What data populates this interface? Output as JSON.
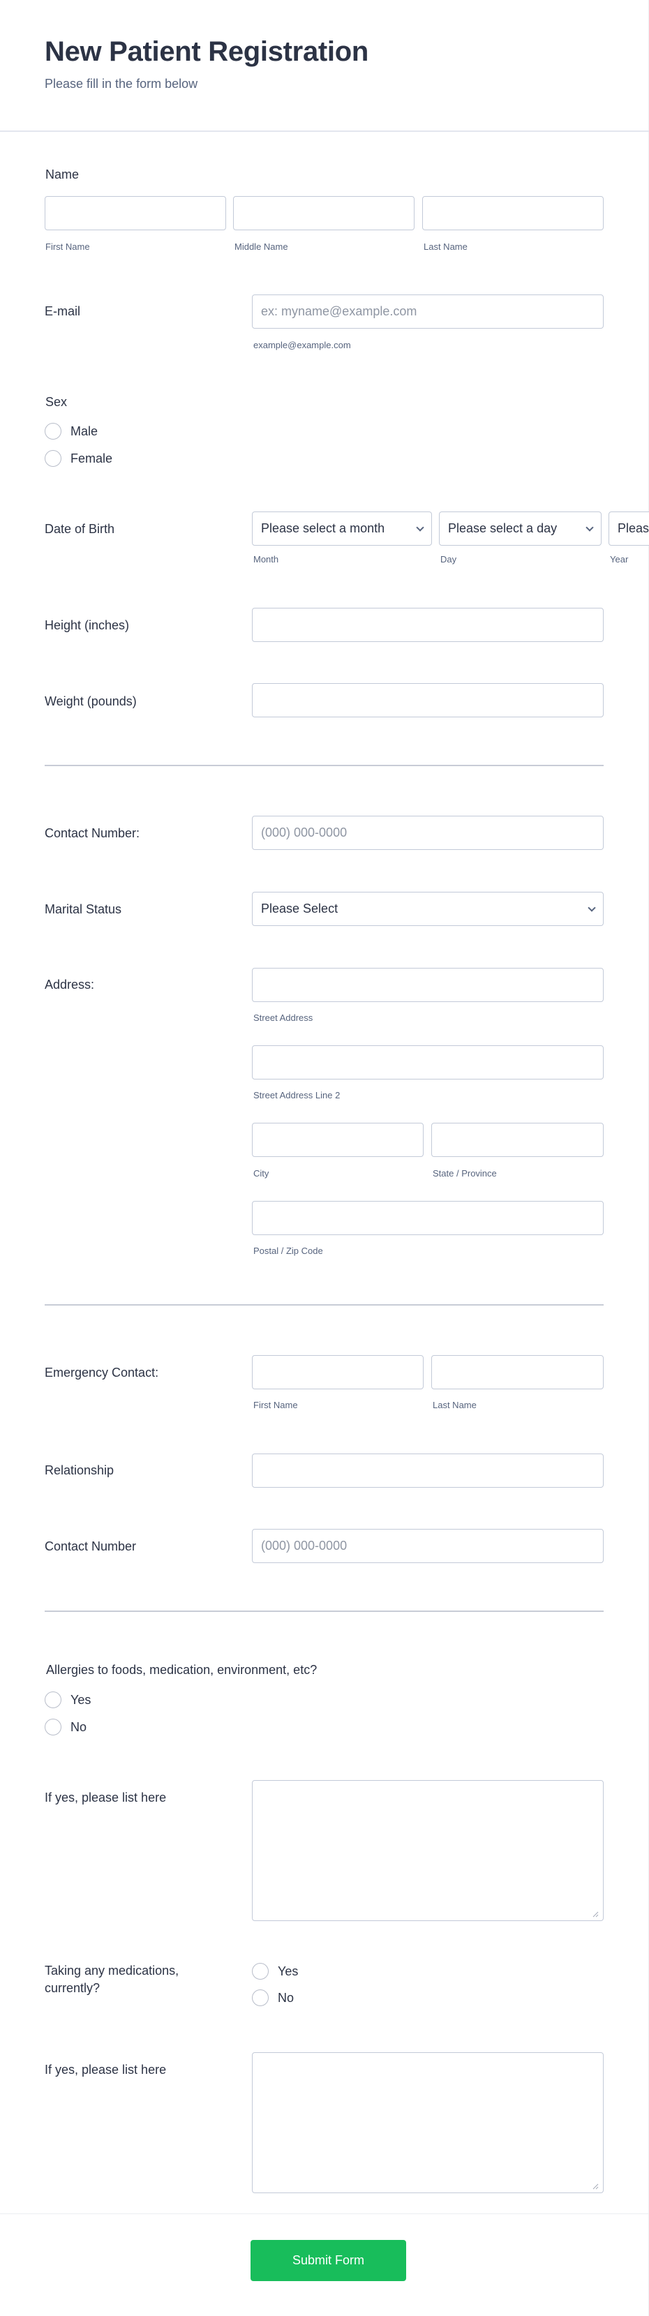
{
  "header": {
    "title": "New Patient Registration",
    "subtitle": "Please fill in the form below"
  },
  "name": {
    "label": "Name",
    "first": {
      "value": "",
      "sublabel": "First Name"
    },
    "middle": {
      "value": "",
      "sublabel": "Middle Name"
    },
    "last": {
      "value": "",
      "sublabel": "Last Name"
    }
  },
  "email": {
    "label": "E-mail",
    "value": "",
    "placeholder": "ex: myname@example.com",
    "sublabel": "example@example.com"
  },
  "sex": {
    "label": "Sex",
    "options": [
      "Male",
      "Female"
    ],
    "selected": null
  },
  "dob": {
    "label": "Date of Birth",
    "month": {
      "value": "Please select a month",
      "sublabel": "Month"
    },
    "day": {
      "value": "Please select a day",
      "sublabel": "Day"
    },
    "year": {
      "value": "Please select a year",
      "sublabel": "Year"
    }
  },
  "height": {
    "label": "Height (inches)",
    "value": ""
  },
  "weight": {
    "label": "Weight (pounds)",
    "value": ""
  },
  "contact": {
    "label": "Contact Number:",
    "value": "",
    "placeholder": "(000) 000-0000"
  },
  "marital": {
    "label": "Marital Status",
    "value": "Please Select"
  },
  "address": {
    "label": "Address:",
    "street1": {
      "value": "",
      "sublabel": "Street Address"
    },
    "street2": {
      "value": "",
      "sublabel": "Street Address Line 2"
    },
    "city": {
      "value": "",
      "sublabel": "City"
    },
    "state": {
      "value": "",
      "sublabel": "State / Province"
    },
    "zip": {
      "value": "",
      "sublabel": "Postal / Zip Code"
    }
  },
  "emergency": {
    "label": "Emergency Contact:",
    "first": {
      "value": "",
      "sublabel": "First Name"
    },
    "last": {
      "value": "",
      "sublabel": "Last Name"
    }
  },
  "relationship": {
    "label": "Relationship",
    "value": ""
  },
  "emergency_contact_number": {
    "label": "Contact Number",
    "value": "",
    "placeholder": "(000) 000-0000"
  },
  "allergies": {
    "label": "Allergies to foods, medication, environment, etc?",
    "options": [
      "Yes",
      "No"
    ],
    "selected": null
  },
  "allergies_list": {
    "label": "If yes, please list here",
    "value": ""
  },
  "medications": {
    "label_line1": "Taking any medications,",
    "label_line2": "currently?",
    "options": [
      "Yes",
      "No"
    ],
    "selected": null
  },
  "medications_list": {
    "label": "If yes, please list here",
    "value": ""
  },
  "submit": {
    "label": "Submit Form",
    "color": "#18bd5b"
  }
}
